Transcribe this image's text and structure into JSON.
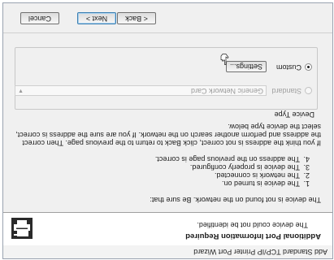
{
  "window": {
    "title": "Add Standard TCP/IP Printer Port Wizard"
  },
  "header": {
    "title": "Additional Port Information Required",
    "subtitle": "The device could not be identified.",
    "icon": "printer-network-icon"
  },
  "body": {
    "intro": "The device is not found on the network.  Be sure that:",
    "checklist": [
      {
        "num": "1.",
        "text": "The device is turned on."
      },
      {
        "num": "2.",
        "text": "The network is connected."
      },
      {
        "num": "3.",
        "text": "The device is properly configured."
      },
      {
        "num": "4.",
        "text": "The address on the previous page is correct."
      }
    ],
    "advice_line1": "If you think the address is not correct, click Back to return to the previous page.  Then correct",
    "advice_line2": "the address and perform another search on the network.  If you are sure the address is correct,",
    "advice_line3": "select the device type below."
  },
  "device_type": {
    "label": "Device Type",
    "standard_label": "Standard",
    "standard_selected": false,
    "standard_enabled": false,
    "standard_value": "Generic Network Card",
    "custom_label": "Custom",
    "custom_selected": true,
    "settings_label": "Settings..."
  },
  "footer": {
    "back_label": "< Back",
    "next_label": "Next >",
    "cancel_label": "Cancel"
  }
}
